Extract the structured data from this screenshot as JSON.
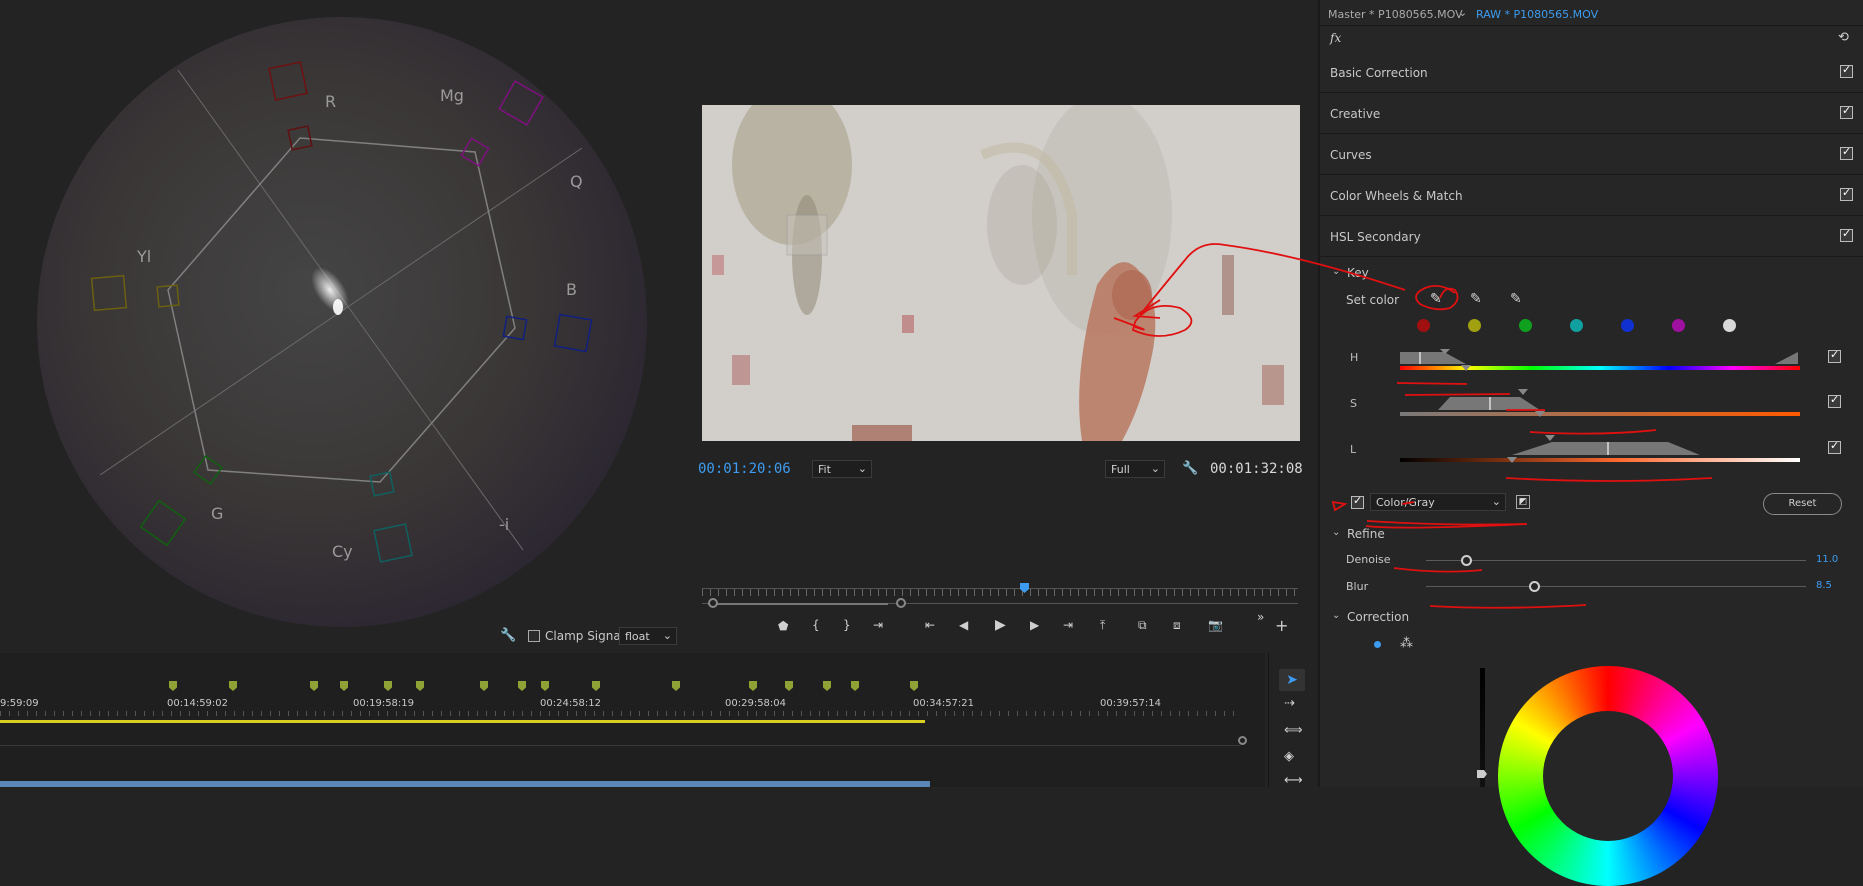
{
  "scope": {
    "labels": {
      "r": "R",
      "mg": "Mg",
      "q": "Q",
      "b": "B",
      "yl": "Yl",
      "g": "G",
      "cy": "Cy",
      "neg_i": "-i"
    },
    "clamp_signal_label": "Clamp Signal",
    "precision_value": "float"
  },
  "monitor": {
    "current_time": "00:01:20:06",
    "zoom_value": "Fit",
    "quality_value": "Full",
    "duration": "00:01:32:08"
  },
  "lumetri": {
    "tabs": {
      "master": "Master * P1080565.MOV",
      "clip": "RAW * P1080565.MOV"
    },
    "fx_label": "fx",
    "sections": [
      {
        "label": "Basic Correction"
      },
      {
        "label": "Creative"
      },
      {
        "label": "Curves"
      },
      {
        "label": "Color Wheels & Match"
      },
      {
        "label": "HSL Secondary"
      }
    ],
    "key": {
      "title": "Key",
      "set_color_label": "Set color",
      "h_label": "H",
      "s_label": "S",
      "l_label": "L",
      "swatch_colors": [
        "#a01010",
        "#a0a010",
        "#10a020",
        "#10a0a0",
        "#1030d0",
        "#a010a0",
        "#d8d8d8"
      ]
    },
    "display_mode": "Color/Gray",
    "reset_label": "Reset",
    "refine": {
      "title": "Refine",
      "denoise_label": "Denoise",
      "denoise_value": "11.0",
      "blur_label": "Blur",
      "blur_value": "8.5"
    },
    "correction": {
      "title": "Correction"
    }
  },
  "timeline": {
    "ruler": [
      "9:59:09",
      "00:14:59:02",
      "00:19:58:19",
      "00:24:58:12",
      "00:29:58:04",
      "00:34:57:21",
      "00:39:57:14"
    ]
  },
  "colors": {
    "accent_blue": "#3d9cf0",
    "marker_green": "#8fa236",
    "annotation_red": "#e01010",
    "work_area_yellow": "#d8d020"
  }
}
